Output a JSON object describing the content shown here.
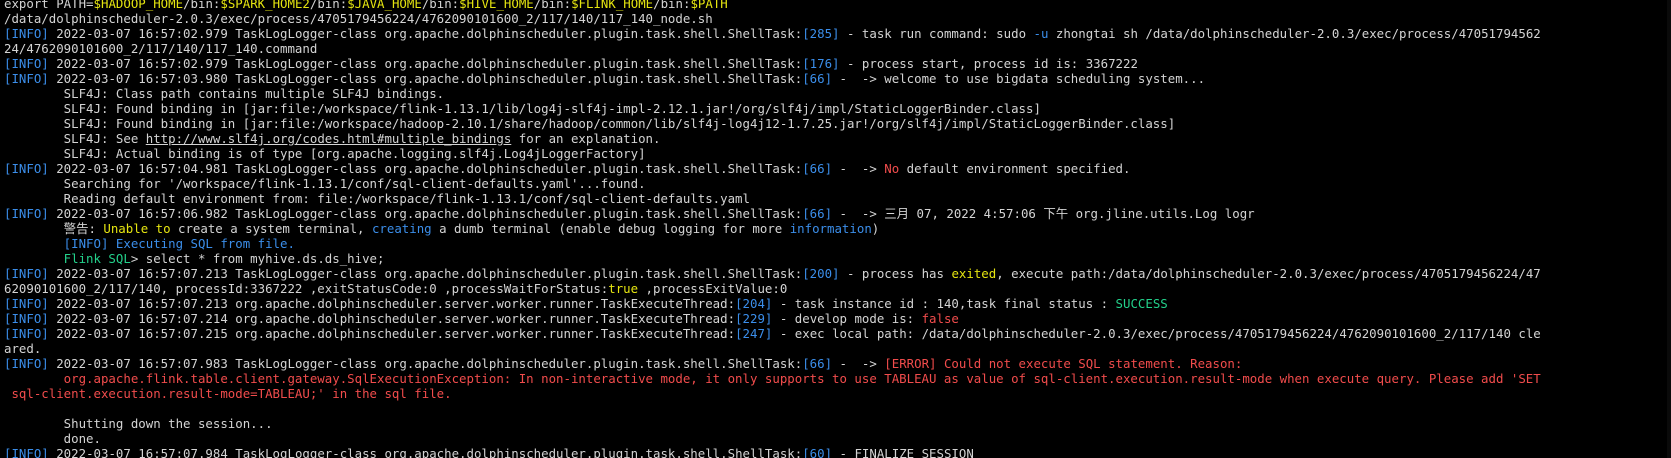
{
  "terminal": {
    "colors": {
      "background": "#000000",
      "default": "#d4d4d4",
      "blue": "#3b8eea",
      "yellow": "#e5e510",
      "red": "#f14c4c",
      "green": "#23d18b"
    },
    "lines": [
      [
        {
          "t": "export PATH=",
          "c": "default"
        },
        {
          "t": "$HADOOP_HOME",
          "c": "yellow"
        },
        {
          "t": "/bin:",
          "c": "default"
        },
        {
          "t": "$SPARK_HOME2",
          "c": "yellow"
        },
        {
          "t": "/bin:",
          "c": "default"
        },
        {
          "t": "$JAVA_HOME",
          "c": "yellow"
        },
        {
          "t": "/bin:",
          "c": "default"
        },
        {
          "t": "$HIVE_HOME",
          "c": "yellow"
        },
        {
          "t": "/bin:",
          "c": "default"
        },
        {
          "t": "$FLINK_HOME",
          "c": "yellow"
        },
        {
          "t": "/bin:",
          "c": "default"
        },
        {
          "t": "$PATH",
          "c": "yellow"
        }
      ],
      [
        {
          "t": "/data/dolphinscheduler-2.0.3/exec/process/4705179456224/4762090101600_2/117/140/117_140_node.sh",
          "c": "default"
        }
      ],
      [
        {
          "t": "[INFO]",
          "c": "blue"
        },
        {
          "t": " 2022-03-07 16:57:02.979 TaskLogLogger-class org.apache.dolphinscheduler.plugin.task.shell.ShellTask:",
          "c": "default"
        },
        {
          "t": "[285]",
          "c": "blue"
        },
        {
          "t": " - task run command: sudo ",
          "c": "default"
        },
        {
          "t": "-u",
          "c": "blue"
        },
        {
          "t": " zhongtai sh /data/dolphinscheduler-2.0.3/exec/process/47051794562",
          "c": "default"
        }
      ],
      [
        {
          "t": "24/4762090101600_2/117/140/117_140.command",
          "c": "default"
        }
      ],
      [
        {
          "t": "[INFO]",
          "c": "blue"
        },
        {
          "t": " 2022-03-07 16:57:02.979 TaskLogLogger-class org.apache.dolphinscheduler.plugin.task.shell.ShellTask:",
          "c": "default"
        },
        {
          "t": "[176]",
          "c": "blue"
        },
        {
          "t": " - process start, process id is: 3367222",
          "c": "default"
        }
      ],
      [
        {
          "t": "[INFO]",
          "c": "blue"
        },
        {
          "t": " 2022-03-07 16:57:03.980 TaskLogLogger-class org.apache.dolphinscheduler.plugin.task.shell.ShellTask:",
          "c": "default"
        },
        {
          "t": "[66]",
          "c": "blue"
        },
        {
          "t": " -  -> welcome to use bigdata scheduling system...",
          "c": "default"
        }
      ],
      [
        {
          "t": "        SLF4J: Class path contains multiple SLF4J bindings.",
          "c": "default"
        }
      ],
      [
        {
          "t": "        SLF4J: Found binding in [jar:file:/workspace/flink-1.13.1/lib/log4j-slf4j-impl-2.12.1.jar!/org/slf4j/impl/StaticLoggerBinder.class]",
          "c": "default"
        }
      ],
      [
        {
          "t": "        SLF4J: Found binding in [jar:file:/workspace/hadoop-2.10.1/share/hadoop/common/lib/slf4j-log4j12-1.7.25.jar!/org/slf4j/impl/StaticLoggerBinder.class]",
          "c": "default"
        }
      ],
      [
        {
          "t": "        SLF4J: See ",
          "c": "default"
        },
        {
          "t": "http://www.slf4j.org/codes.html#multiple_bindings",
          "c": "link"
        },
        {
          "t": " for an explanation.",
          "c": "default"
        }
      ],
      [
        {
          "t": "        SLF4J: Actual binding is of type [org.apache.logging.slf4j.Log4jLoggerFactory]",
          "c": "default"
        }
      ],
      [
        {
          "t": "[INFO]",
          "c": "blue"
        },
        {
          "t": " 2022-03-07 16:57:04.981 TaskLogLogger-class org.apache.dolphinscheduler.plugin.task.shell.ShellTask:",
          "c": "default"
        },
        {
          "t": "[66]",
          "c": "blue"
        },
        {
          "t": " -  -> ",
          "c": "default"
        },
        {
          "t": "No",
          "c": "red"
        },
        {
          "t": " default environment specified.",
          "c": "default"
        }
      ],
      [
        {
          "t": "        Searching for '/workspace/flink-1.13.1/conf/sql-client-defaults.yaml'...found.",
          "c": "default"
        }
      ],
      [
        {
          "t": "        Reading default environment from: file:/workspace/flink-1.13.1/conf/sql-client-defaults.yaml",
          "c": "default"
        }
      ],
      [
        {
          "t": "[INFO]",
          "c": "blue"
        },
        {
          "t": " 2022-03-07 16:57:06.982 TaskLogLogger-class org.apache.dolphinscheduler.plugin.task.shell.ShellTask:",
          "c": "default"
        },
        {
          "t": "[66]",
          "c": "blue"
        },
        {
          "t": " -  -> 三月 07, 2022 4:57:06 下午 org.jline.utils.Log logr",
          "c": "default"
        }
      ],
      [
        {
          "t": "        警告: ",
          "c": "default"
        },
        {
          "t": "Unable to",
          "c": "yellow"
        },
        {
          "t": " create a system terminal, ",
          "c": "default"
        },
        {
          "t": "creating",
          "c": "blue"
        },
        {
          "t": " a dumb terminal (enable debug logging for more ",
          "c": "default"
        },
        {
          "t": "information",
          "c": "blue"
        },
        {
          "t": ")",
          "c": "default"
        }
      ],
      [
        {
          "t": "        [INFO] Executing SQL from file.",
          "c": "blue"
        }
      ],
      [
        {
          "t": "        Flink SQL",
          "c": "green"
        },
        {
          "t": "> select * from myhive.ds.ds_hive;",
          "c": "default"
        }
      ],
      [
        {
          "t": "[INFO]",
          "c": "blue"
        },
        {
          "t": " 2022-03-07 16:57:07.213 TaskLogLogger-class org.apache.dolphinscheduler.plugin.task.shell.ShellTask:",
          "c": "default"
        },
        {
          "t": "[200]",
          "c": "blue"
        },
        {
          "t": " - process has ",
          "c": "default"
        },
        {
          "t": "exited",
          "c": "yellow"
        },
        {
          "t": ", execute path:/data/dolphinscheduler-2.0.3/exec/process/4705179456224/47",
          "c": "default"
        }
      ],
      [
        {
          "t": "62090101600_2/117/140, processId:3367222 ,exitStatusCode:0 ,processWaitForStatus:",
          "c": "default"
        },
        {
          "t": "true",
          "c": "yellow"
        },
        {
          "t": " ,processExitValue:0",
          "c": "default"
        }
      ],
      [
        {
          "t": "[INFO]",
          "c": "blue"
        },
        {
          "t": " 2022-03-07 16:57:07.213 org.apache.dolphinscheduler.server.worker.runner.TaskExecuteThread:",
          "c": "default"
        },
        {
          "t": "[204]",
          "c": "blue"
        },
        {
          "t": " - task instance id : 140,task final status : ",
          "c": "default"
        },
        {
          "t": "SUCCESS",
          "c": "green"
        }
      ],
      [
        {
          "t": "[INFO]",
          "c": "blue"
        },
        {
          "t": " 2022-03-07 16:57:07.214 org.apache.dolphinscheduler.server.worker.runner.TaskExecuteThread:",
          "c": "default"
        },
        {
          "t": "[229]",
          "c": "blue"
        },
        {
          "t": " - develop mode is: ",
          "c": "default"
        },
        {
          "t": "false",
          "c": "red"
        }
      ],
      [
        {
          "t": "[INFO]",
          "c": "blue"
        },
        {
          "t": " 2022-03-07 16:57:07.215 org.apache.dolphinscheduler.server.worker.runner.TaskExecuteThread:",
          "c": "default"
        },
        {
          "t": "[247]",
          "c": "blue"
        },
        {
          "t": " - exec local path: /data/dolphinscheduler-2.0.3/exec/process/4705179456224/4762090101600_2/117/140 cle",
          "c": "default"
        }
      ],
      [
        {
          "t": "ared.",
          "c": "default"
        }
      ],
      [
        {
          "t": "[INFO]",
          "c": "blue"
        },
        {
          "t": " 2022-03-07 16:57:07.983 TaskLogLogger-class org.apache.dolphinscheduler.plugin.task.shell.ShellTask:",
          "c": "default"
        },
        {
          "t": "[66]",
          "c": "blue"
        },
        {
          "t": " -  -> ",
          "c": "default"
        },
        {
          "t": "[ERROR] Could not execute SQL statement. Reason:",
          "c": "red"
        }
      ],
      [
        {
          "t": "        org.apache.flink.table.client.gateway.SqlExecutionException: In non-interactive mode, it only supports to use TABLEAU as value of sql-client.execution.result-mode when execute query. Please add 'SET",
          "c": "red"
        }
      ],
      [
        {
          "t": " sql-client.execution.result-mode=TABLEAU;' in the sql file.",
          "c": "red"
        }
      ],
      [
        {
          "t": "",
          "c": "default"
        }
      ],
      [
        {
          "t": "        Shutting down the session...",
          "c": "default"
        }
      ],
      [
        {
          "t": "        done.",
          "c": "default"
        }
      ],
      [
        {
          "t": "[INFO]",
          "c": "blue"
        },
        {
          "t": " 2022-03-07 16:57:07.984 TaskLogLogger-class org.apache.dolphinscheduler.plugin.task.shell.ShellTask:",
          "c": "default"
        },
        {
          "t": "[60]",
          "c": "blue"
        },
        {
          "t": " - FINALIZE_SESSION",
          "c": "default"
        }
      ]
    ]
  }
}
